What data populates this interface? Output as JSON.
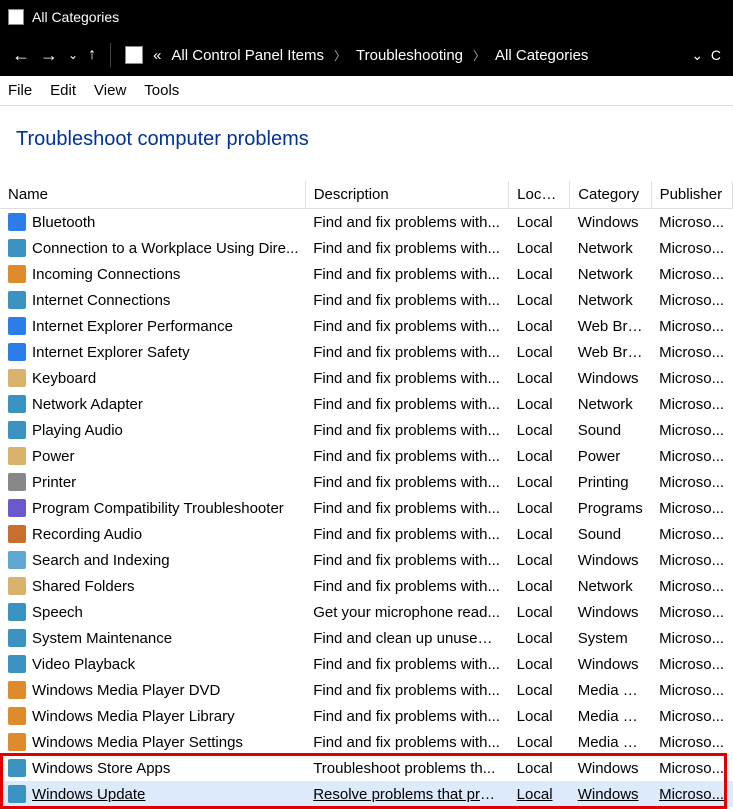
{
  "window": {
    "title": "All Categories"
  },
  "breadcrumb": {
    "pre": "«",
    "items": [
      "All Control Panel Items",
      "Troubleshooting",
      "All Categories"
    ]
  },
  "menu": {
    "file": "File",
    "edit": "Edit",
    "view": "View",
    "tools": "Tools"
  },
  "heading": "Troubleshoot computer problems",
  "columns": {
    "name": "Name",
    "description": "Description",
    "location": "Locat...",
    "category": "Category",
    "publisher": "Publisher"
  },
  "rows": [
    {
      "name": "Bluetooth",
      "desc": "Find and fix problems with...",
      "loc": "Local",
      "cat": "Windows",
      "pub": "Microso..."
    },
    {
      "name": "Connection to a Workplace Using Dire...",
      "desc": "Find and fix problems with...",
      "loc": "Local",
      "cat": "Network",
      "pub": "Microso..."
    },
    {
      "name": "Incoming Connections",
      "desc": "Find and fix problems with...",
      "loc": "Local",
      "cat": "Network",
      "pub": "Microso..."
    },
    {
      "name": "Internet Connections",
      "desc": "Find and fix problems with...",
      "loc": "Local",
      "cat": "Network",
      "pub": "Microso..."
    },
    {
      "name": "Internet Explorer Performance",
      "desc": "Find and fix problems with...",
      "loc": "Local",
      "cat": "Web Bro...",
      "pub": "Microso..."
    },
    {
      "name": "Internet Explorer Safety",
      "desc": "Find and fix problems with...",
      "loc": "Local",
      "cat": "Web Bro...",
      "pub": "Microso..."
    },
    {
      "name": "Keyboard",
      "desc": "Find and fix problems with...",
      "loc": "Local",
      "cat": "Windows",
      "pub": "Microso..."
    },
    {
      "name": "Network Adapter",
      "desc": "Find and fix problems with...",
      "loc": "Local",
      "cat": "Network",
      "pub": "Microso..."
    },
    {
      "name": "Playing Audio",
      "desc": "Find and fix problems with...",
      "loc": "Local",
      "cat": "Sound",
      "pub": "Microso..."
    },
    {
      "name": "Power",
      "desc": "Find and fix problems with...",
      "loc": "Local",
      "cat": "Power",
      "pub": "Microso..."
    },
    {
      "name": "Printer",
      "desc": "Find and fix problems with...",
      "loc": "Local",
      "cat": "Printing",
      "pub": "Microso..."
    },
    {
      "name": "Program Compatibility Troubleshooter",
      "desc": "Find and fix problems with...",
      "loc": "Local",
      "cat": "Programs",
      "pub": "Microso..."
    },
    {
      "name": "Recording Audio",
      "desc": "Find and fix problems with...",
      "loc": "Local",
      "cat": "Sound",
      "pub": "Microso..."
    },
    {
      "name": "Search and Indexing",
      "desc": "Find and fix problems with...",
      "loc": "Local",
      "cat": "Windows",
      "pub": "Microso..."
    },
    {
      "name": "Shared Folders",
      "desc": "Find and fix problems with...",
      "loc": "Local",
      "cat": "Network",
      "pub": "Microso..."
    },
    {
      "name": "Speech",
      "desc": "Get your microphone read...",
      "loc": "Local",
      "cat": "Windows",
      "pub": "Microso..."
    },
    {
      "name": "System Maintenance",
      "desc": "Find and clean up unused f...",
      "loc": "Local",
      "cat": "System",
      "pub": "Microso..."
    },
    {
      "name": "Video Playback",
      "desc": "Find and fix problems with...",
      "loc": "Local",
      "cat": "Windows",
      "pub": "Microso..."
    },
    {
      "name": "Windows Media Player DVD",
      "desc": "Find and fix problems with...",
      "loc": "Local",
      "cat": "Media P...",
      "pub": "Microso..."
    },
    {
      "name": "Windows Media Player Library",
      "desc": "Find and fix problems with...",
      "loc": "Local",
      "cat": "Media P...",
      "pub": "Microso..."
    },
    {
      "name": "Windows Media Player Settings",
      "desc": "Find and fix problems with...",
      "loc": "Local",
      "cat": "Media P...",
      "pub": "Microso..."
    },
    {
      "name": "Windows Store Apps",
      "desc": "Troubleshoot problems th...",
      "loc": "Local",
      "cat": "Windows",
      "pub": "Microso..."
    },
    {
      "name": "Windows Update",
      "desc": "Resolve problems that pre...",
      "loc": "Local",
      "cat": "Windows",
      "pub": "Microso...",
      "selected": true
    }
  ]
}
